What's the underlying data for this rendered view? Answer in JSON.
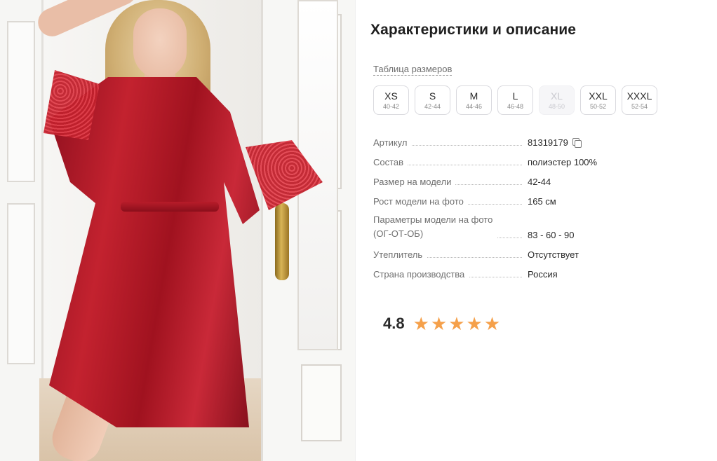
{
  "title": "Характеристики и описание",
  "size_table_link": "Таблица размеров",
  "sizes": [
    {
      "label": "XS",
      "range": "40-42",
      "available": true
    },
    {
      "label": "S",
      "range": "42-44",
      "available": true
    },
    {
      "label": "M",
      "range": "44-46",
      "available": true
    },
    {
      "label": "L",
      "range": "46-48",
      "available": true
    },
    {
      "label": "XL",
      "range": "48-50",
      "available": false
    },
    {
      "label": "XXL",
      "range": "50-52",
      "available": true
    },
    {
      "label": "XXXL",
      "range": "52-54",
      "available": true
    }
  ],
  "specs": [
    {
      "key": "Артикул",
      "value": "81319179",
      "copy_icon": "copy-icon"
    },
    {
      "key": "Состав",
      "value": "полиэстер 100%"
    },
    {
      "key": "Размер на модели",
      "value": "42-44"
    },
    {
      "key": "Рост модели на фото",
      "value": "165 см"
    },
    {
      "key_line1": "Параметры модели на фото",
      "key_line2": "(ОГ-ОТ-ОБ)",
      "value": "83 - 60 - 90"
    },
    {
      "key": "Утеплитель",
      "value": "Отсутствует"
    },
    {
      "key": "Страна производства",
      "value": "Россия"
    }
  ],
  "rating": {
    "value": "4.8",
    "stars": 5,
    "star_color": "#f5a04a"
  },
  "colors": {
    "accent_star": "#f5a04a",
    "robe": "#b81c2a"
  }
}
